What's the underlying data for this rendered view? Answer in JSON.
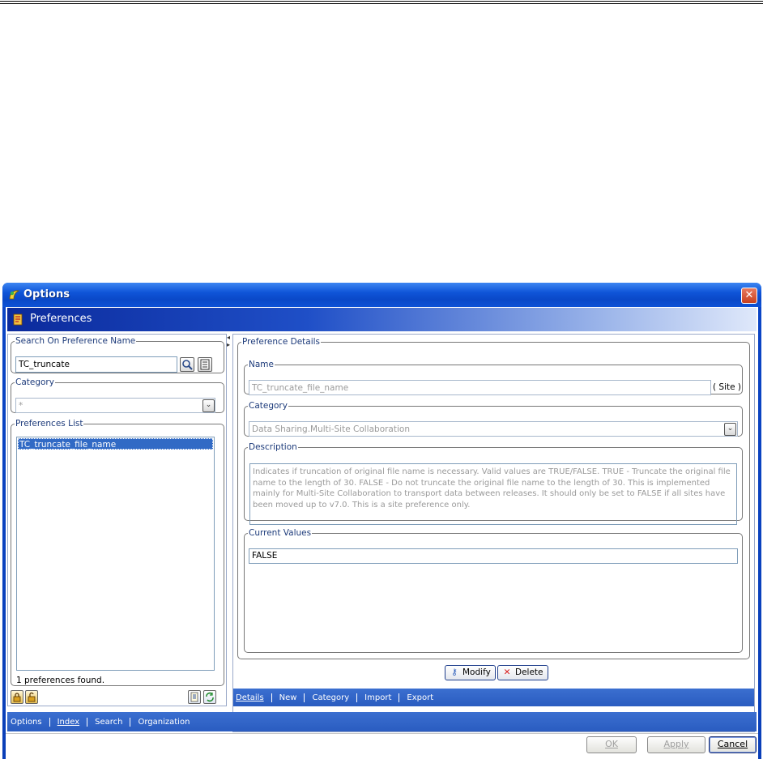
{
  "window": {
    "title": "Options",
    "close_glyph": "✕"
  },
  "header": {
    "title": "Preferences"
  },
  "search": {
    "legend": "Search On Preference Name",
    "value": "TC_truncate"
  },
  "category_filter": {
    "legend": "Category",
    "value": "*"
  },
  "pref_list": {
    "legend": "Preferences List",
    "items": [
      "TC_truncate_file_name"
    ],
    "status": "1 preferences found."
  },
  "details": {
    "legend": "Preference Details",
    "name_legend": "Name",
    "name_value": "TC_truncate_file_name",
    "scope": "( Site )",
    "category_legend": "Category",
    "category_value": "Data Sharing.Multi-Site Collaboration",
    "description_legend": "Description",
    "description_text": "Indicates if truncation of original file name is necessary. Valid values are TRUE/FALSE. TRUE - Truncate the original file name to the length of 30. FALSE - Do not truncate the original file name to the length of 30. This is implemented mainly for Multi-Site Collaboration to transport data between releases. It should only be set to FALSE if all sites have been moved up to v7.0. This is a site preference only.",
    "current_values_legend": "Current Values",
    "current_values": [
      "FALSE"
    ]
  },
  "actions": {
    "modify": "Modify",
    "delete": "Delete"
  },
  "right_tabs": [
    "Details",
    "New",
    "Category",
    "Import",
    "Export"
  ],
  "right_tabs_active": "Details",
  "bottom_tabs": [
    "Options",
    "Index",
    "Search",
    "Organization"
  ],
  "bottom_tabs_active": "Index",
  "footer": {
    "ok": "OK",
    "apply": "Apply",
    "cancel": "Cancel"
  },
  "icons": {
    "window": "app-logo-icon",
    "header": "preferences-icon",
    "search": "magnifier-icon",
    "browse": "list-icon",
    "lock": "lock-icon",
    "unlock": "unlock-icon",
    "export_list": "document-icon",
    "refresh": "refresh-icon",
    "modify": "key-icon",
    "delete": "red-x-icon"
  },
  "colors": {
    "title_bar": "#0a48c8",
    "tab_bar": "#2a5cc0",
    "selection": "#316ac5",
    "legend_text": "#1c3a7a"
  }
}
